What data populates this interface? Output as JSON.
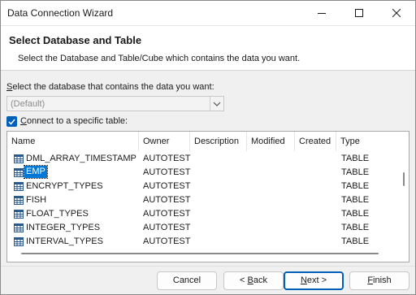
{
  "window": {
    "title": "Data Connection Wizard"
  },
  "header": {
    "title": "Select Database and Table",
    "subtitle": "Select the Database and Table/Cube which contains the data you want."
  },
  "database": {
    "label": "Select the database that contains the data you want:",
    "value": "(Default)"
  },
  "specific_table": {
    "label": "Connect to a specific table:",
    "checked": true
  },
  "table": {
    "columns": [
      "Name",
      "Owner",
      "Description",
      "Modified",
      "Created",
      "Type"
    ],
    "rows": [
      {
        "name": "DML_ARRAY_TIMESTAMP",
        "owner": "AUTOTEST",
        "type": "TABLE"
      },
      {
        "name": "EMP",
        "owner": "AUTOTEST",
        "type": "TABLE",
        "selected": true
      },
      {
        "name": "ENCRYPT_TYPES",
        "owner": "AUTOTEST",
        "type": "TABLE"
      },
      {
        "name": "FISH",
        "owner": "AUTOTEST",
        "type": "TABLE"
      },
      {
        "name": "FLOAT_TYPES",
        "owner": "AUTOTEST",
        "type": "TABLE"
      },
      {
        "name": "INTEGER_TYPES",
        "owner": "AUTOTEST",
        "type": "TABLE"
      },
      {
        "name": "INTERVAL_TYPES",
        "owner": "AUTOTEST",
        "type": "TABLE"
      }
    ],
    "row_icon": "table-grid-icon"
  },
  "buttons": {
    "cancel": "Cancel",
    "back": "< Back",
    "next": "Next >",
    "finish": "Finish"
  },
  "colors": {
    "accent": "#005fb8",
    "selection": "#0078d7"
  }
}
